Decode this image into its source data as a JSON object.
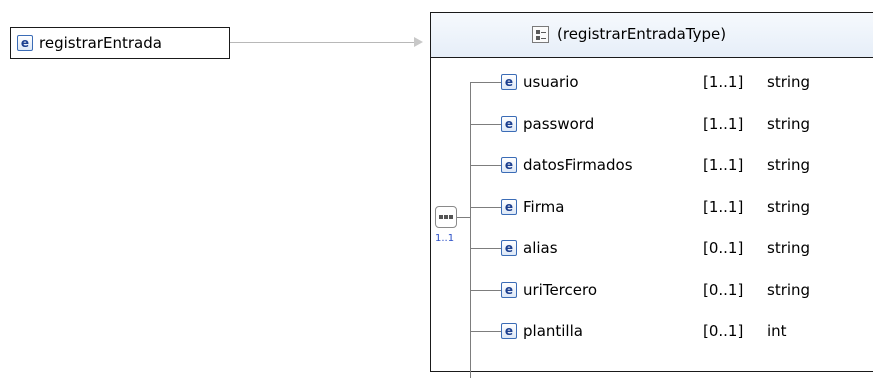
{
  "root": {
    "icon": "element-icon",
    "icon_letter": "e",
    "name": "registrarEntrada"
  },
  "complex_type": {
    "icon": "complex-type-icon",
    "title": "(registrarEntradaType)"
  },
  "sequence": {
    "icon": "sequence-icon",
    "cardinality": "1..1"
  },
  "elements": [
    {
      "name": "usuario",
      "cardinality": "[1..1]",
      "type": "string"
    },
    {
      "name": "password",
      "cardinality": "[1..1]",
      "type": "string"
    },
    {
      "name": "datosFirmados",
      "cardinality": "[1..1]",
      "type": "string"
    },
    {
      "name": "Firma",
      "cardinality": "[1..1]",
      "type": "string"
    },
    {
      "name": "alias",
      "cardinality": "[0..1]",
      "type": "string"
    },
    {
      "name": "uriTercero",
      "cardinality": "[0..1]",
      "type": "string"
    },
    {
      "name": "plantilla",
      "cardinality": "[0..1]",
      "type": "int"
    }
  ]
}
